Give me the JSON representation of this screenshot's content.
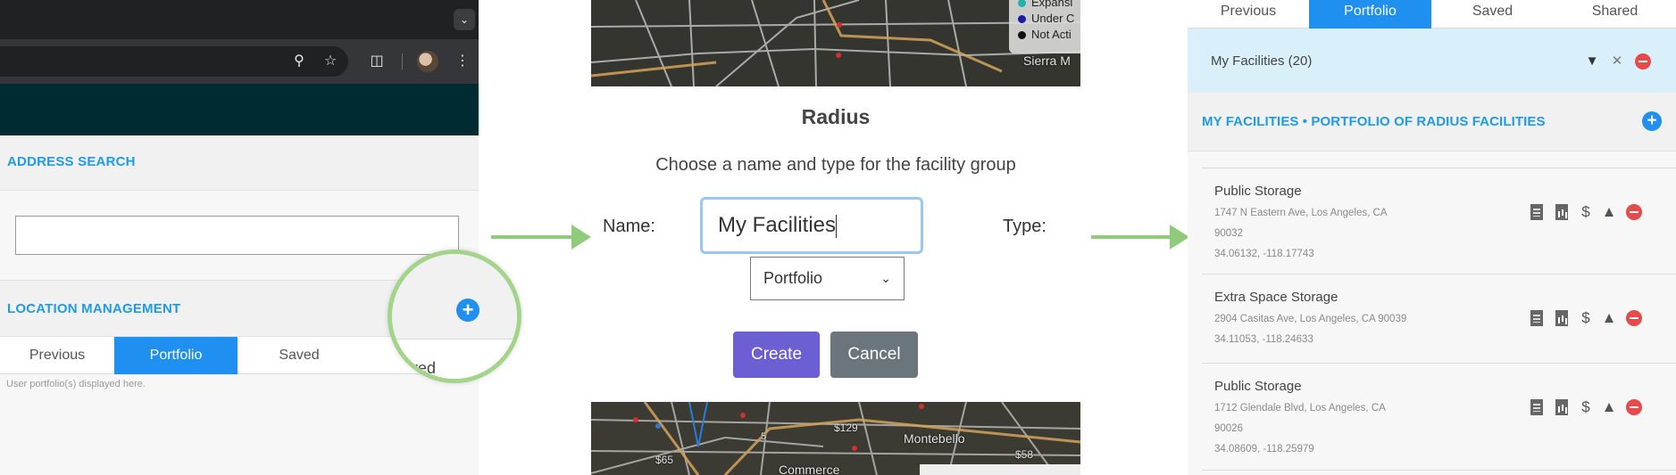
{
  "panel1": {
    "toolbar_icons": [
      "zoom-icon",
      "star-icon",
      "extension-icon",
      "avatar",
      "menu-icon"
    ],
    "address_search": {
      "title": "ADDRESS SEARCH",
      "placeholder": ""
    },
    "location_management": {
      "title": "LOCATION MANAGEMENT",
      "tabs": [
        "Previous",
        "Portfolio",
        "Saved",
        "Shared"
      ],
      "active_tab": "Portfolio",
      "note": "User portfolio(s) displayed here."
    },
    "zoom_label": "ared"
  },
  "panel2": {
    "legend": [
      {
        "label": "Expansi",
        "color": "#20b2aa"
      },
      {
        "label": "Under C",
        "color": "#1a1aa6"
      },
      {
        "label": "Not Acti",
        "color": "#111111"
      }
    ],
    "map_top_labels": [
      "Sierra M"
    ],
    "map_bottom_labels": [
      "$129",
      "Montebello",
      "5",
      "$65",
      "$58",
      "Commerce"
    ],
    "dialog": {
      "title": "Radius",
      "subtitle": "Choose a name and type for the facility group",
      "name_label": "Name:",
      "name_value": "My Facilities",
      "type_label": "Type:",
      "type_value": "Portfolio",
      "create_label": "Create",
      "cancel_label": "Cancel"
    }
  },
  "panel3": {
    "tabs": [
      "Previous",
      "Portfolio",
      "Saved",
      "Shared"
    ],
    "active_tab": "Portfolio",
    "group": "My Facilities (20)",
    "portfolio_title": "MY FACILITIES • PORTFOLIO OF RADIUS FACILITIES",
    "facilities": [
      {
        "name": "Public Storage",
        "address_line1": "1747 N Eastern Ave, Los Angeles, CA",
        "address_line2": "90032",
        "coords": "34.06132, -118.17743"
      },
      {
        "name": "Extra Space Storage",
        "address_line1": "2904 Casitas Ave, Los Angeles, CA 90039",
        "address_line2": "",
        "coords": "34.11053, -118.24633"
      },
      {
        "name": "Public Storage",
        "address_line1": "1712 Glendale Blvd, Los Angeles, CA",
        "address_line2": "90026",
        "coords": "34.08609, -118.25979"
      }
    ]
  },
  "colors": {
    "accent_blue": "#1f8ff0",
    "section_title": "#1e9be9",
    "create_button": "#6b5fd3",
    "cancel_button": "#6b757c",
    "arrow_green": "#8fcb7a",
    "remove_red": "#e64a4a"
  }
}
